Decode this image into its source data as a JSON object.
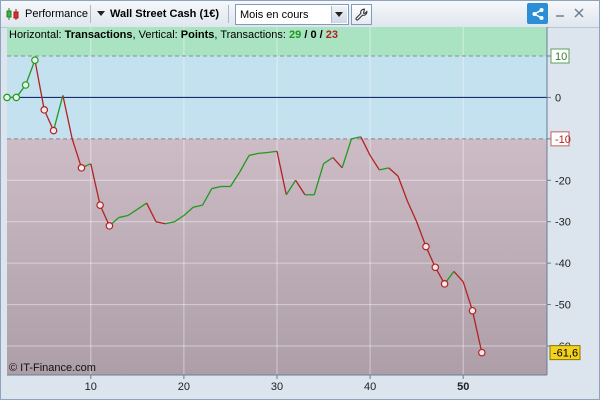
{
  "toolbar": {
    "performance_label": "Performance",
    "instrument_label": "Wall Street Cash (1€)",
    "period_value": "Mois en cours"
  },
  "chart_data": {
    "type": "line",
    "header": {
      "prefix_h": "Horizontal: ",
      "h_value": "Transactions",
      "prefix_v": ", Vertical: ",
      "v_value": "Points",
      "prefix_t": ", Transactions: ",
      "wins": "29",
      "slash1": " / ",
      "neutral": "0",
      "slash2": " / ",
      "losses": "23"
    },
    "xlim": [
      1,
      59
    ],
    "ylim": [
      -67,
      17
    ],
    "x_ticks": [
      10,
      20,
      30,
      40,
      50
    ],
    "x_tick_labels": [
      "10",
      "20",
      "30",
      "40",
      "50"
    ],
    "bold_x_tick": 50,
    "y_ticks": [
      10,
      0,
      -10,
      -20,
      -30,
      -40,
      -50,
      -60
    ],
    "y_tick_labels": [
      "10",
      "0",
      "-10",
      "-20",
      "-30",
      "-40",
      "-50",
      "-60"
    ],
    "band_upper": 10,
    "band_lower": -10,
    "last_value_label": "-61,6",
    "copyright": "© IT-Finance.com",
    "colors": {
      "up": "#1f9a1f",
      "down": "#b22222",
      "zone_high": "#a9e3c2",
      "zone_mid": "#c3e1ef",
      "zone_low_top": "#cdbcc6",
      "zone_low_bottom": "#ad9ea8",
      "zero_line": "#1a2d6e",
      "last_box": "#f2d21e"
    },
    "values": [
      [
        1,
        0
      ],
      [
        2,
        0
      ],
      [
        3,
        3
      ],
      [
        4,
        9
      ],
      [
        5,
        -3
      ],
      [
        6,
        -8
      ],
      [
        7,
        0.5
      ],
      [
        8,
        -10
      ],
      [
        9,
        -17
      ],
      [
        10,
        -16
      ],
      [
        11,
        -26
      ],
      [
        12,
        -31
      ],
      [
        13,
        -29
      ],
      [
        14,
        -28.5
      ],
      [
        15,
        -27
      ],
      [
        16,
        -25.5
      ],
      [
        17,
        -30
      ],
      [
        18,
        -30.5
      ],
      [
        19,
        -30
      ],
      [
        20,
        -28.5
      ],
      [
        21,
        -26.5
      ],
      [
        22,
        -26
      ],
      [
        23,
        -22
      ],
      [
        24,
        -21.5
      ],
      [
        25,
        -21.5
      ],
      [
        26,
        -18
      ],
      [
        27,
        -14
      ],
      [
        28,
        -13.5
      ],
      [
        29,
        -13.3
      ],
      [
        30,
        -13
      ],
      [
        31,
        -23.5
      ],
      [
        32,
        -20
      ],
      [
        33,
        -23.5
      ],
      [
        34,
        -23.5
      ],
      [
        35,
        -16
      ],
      [
        36,
        -14.5
      ],
      [
        37,
        -17
      ],
      [
        38,
        -10
      ],
      [
        39,
        -9.5
      ],
      [
        40,
        -14
      ],
      [
        41,
        -17.5
      ],
      [
        42,
        -17
      ],
      [
        43,
        -19
      ],
      [
        44,
        -25
      ],
      [
        45,
        -30
      ],
      [
        46,
        -36
      ],
      [
        47,
        -41
      ],
      [
        48,
        -45
      ],
      [
        49,
        -42
      ],
      [
        50,
        -44.5
      ],
      [
        51,
        -51.5
      ],
      [
        52,
        -61.6
      ]
    ],
    "markers_up": [
      1,
      2,
      3,
      4
    ],
    "markers_down": [
      5,
      6,
      9,
      11,
      12,
      46,
      47,
      48,
      51,
      52
    ]
  }
}
